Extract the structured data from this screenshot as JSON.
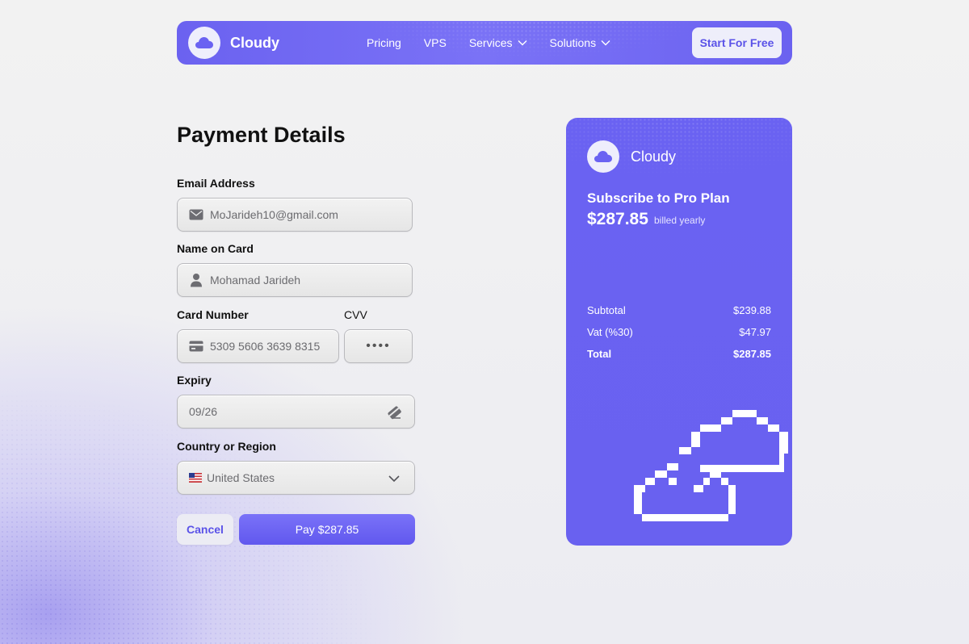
{
  "nav": {
    "brand": "Cloudy",
    "links": [
      {
        "label": "Pricing"
      },
      {
        "label": "VPS"
      },
      {
        "label": "Services",
        "has_dropdown": true
      },
      {
        "label": "Solutions",
        "has_dropdown": true
      }
    ],
    "cta": "Start For Free"
  },
  "form": {
    "title": "Payment Details",
    "email": {
      "label": "Email Address",
      "value": "MoJarideh10@gmail.com",
      "icon": "mail-icon"
    },
    "name": {
      "label": "Name on Card",
      "value": "Mohamad Jarideh",
      "icon": "user-icon"
    },
    "card_number": {
      "label": "Card Number",
      "value": "5309 5606 3639 8315",
      "icon": "credit-card-icon"
    },
    "cvv": {
      "label": "CVV",
      "value": "••••"
    },
    "expiry": {
      "label": "Expiry",
      "value": "09/26",
      "icon": "card-chip-icon"
    },
    "country": {
      "label": "Country or Region",
      "value": "United States",
      "icon": "us-flag-icon"
    },
    "cancel": "Cancel",
    "pay": "Pay $287.85"
  },
  "summary": {
    "brand": "Cloudy",
    "plan": "Subscribe to Pro Plan",
    "price": "$287.85",
    "billing": "billed yearly",
    "lines": [
      {
        "label": "Subtotal",
        "value": "$239.88"
      },
      {
        "label": "Vat (%30)",
        "value": "$47.97"
      },
      {
        "label": "Total",
        "value": "$287.85"
      }
    ]
  },
  "colors": {
    "accent": "#6A62F2",
    "background": "#F0F0F0",
    "field_bg": "#ECECEC",
    "text": "#111111"
  }
}
